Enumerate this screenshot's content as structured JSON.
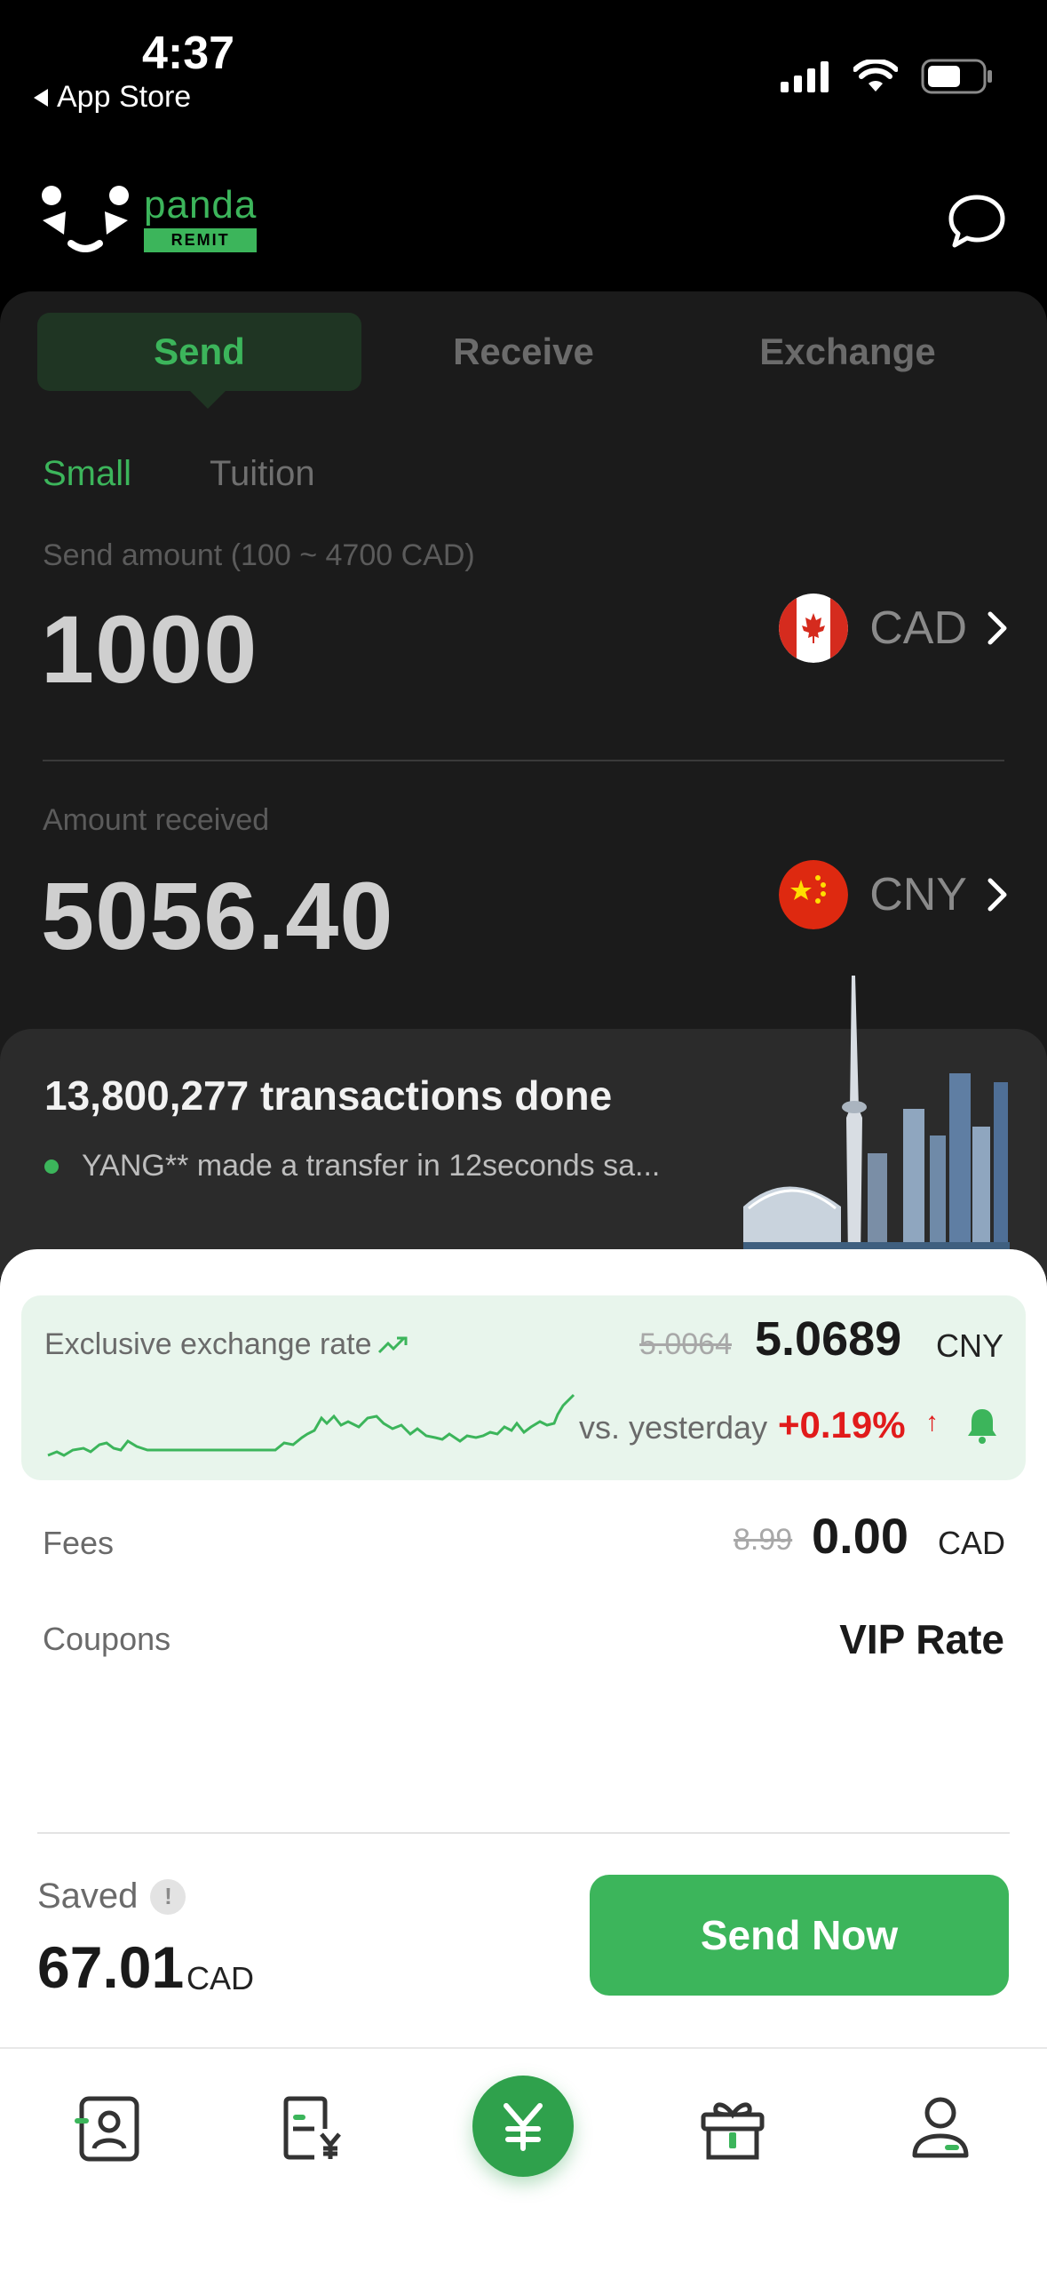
{
  "status_bar": {
    "time": "4:37",
    "back_label": "App Store"
  },
  "header": {
    "logo_word": "panda",
    "logo_tag": "REMIT"
  },
  "tabs": [
    {
      "label": "Send"
    },
    {
      "label": "Receive"
    },
    {
      "label": "Exchange"
    }
  ],
  "subtabs": [
    {
      "label": "Small"
    },
    {
      "label": "Tuition"
    }
  ],
  "send": {
    "label": "Send amount (100 ~ 4700 CAD)",
    "amount": "1000",
    "currency": "CAD"
  },
  "receive": {
    "label": "Amount received",
    "amount": "5056.40",
    "currency": "CNY"
  },
  "transactions": {
    "title": "13,800,277 transactions done",
    "subtitle": "YANG** made a transfer in 12seconds sa..."
  },
  "rate": {
    "label": "Exclusive exchange rate",
    "old_rate": "5.0064",
    "new_rate": "5.0689",
    "currency": "CNY",
    "vs_label": "vs. yesterday",
    "change": "+0.19%"
  },
  "fees": {
    "label": "Fees",
    "old": "8.99",
    "new": "0.00",
    "currency": "CAD"
  },
  "coupons": {
    "label": "Coupons",
    "value": "VIP Rate"
  },
  "saved": {
    "label": "Saved",
    "info": "!",
    "amount": "67.01",
    "currency": "CAD"
  },
  "send_button": {
    "label": "Send Now"
  },
  "colors": {
    "accent": "#3cb55b",
    "negative": "#e11b1b",
    "dark_bg": "#1b1b1b"
  },
  "bottom_nav": [
    {
      "icon": "contacts-icon"
    },
    {
      "icon": "bill-yuan-icon"
    },
    {
      "icon": "yuan-icon"
    },
    {
      "icon": "gift-icon"
    },
    {
      "icon": "profile-icon"
    }
  ]
}
